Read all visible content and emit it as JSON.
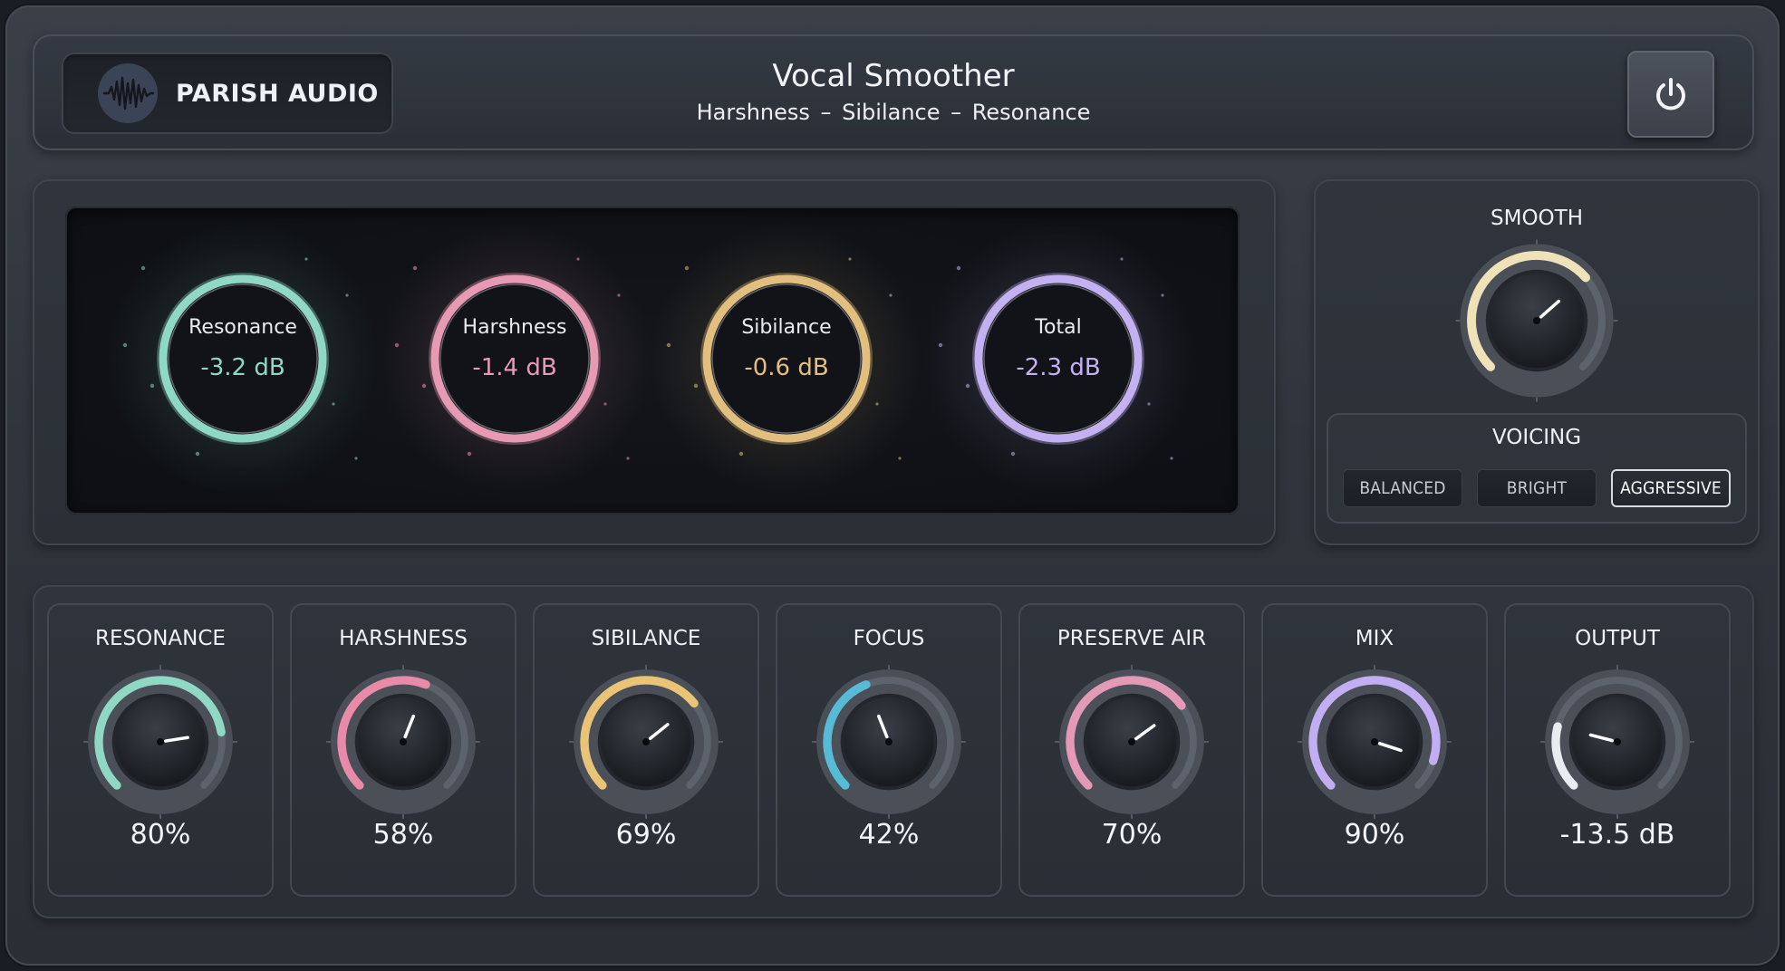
{
  "header": {
    "brand_name": "PARISH AUDIO",
    "title": "Vocal Smoother",
    "subtitle": "Harshness  –  Sibilance  –  Resonance"
  },
  "meters": [
    {
      "label": "Resonance",
      "value": "-3.2 dB",
      "color": "#8fd9c4"
    },
    {
      "label": "Harshness",
      "value": "-1.4 dB",
      "color": "#e79ab3"
    },
    {
      "label": "Sibilance",
      "value": "-0.6 dB",
      "color": "#e2bf7e"
    },
    {
      "label": "Total",
      "value": "-2.3 dB",
      "color": "#c4b1f2"
    }
  ],
  "smooth": {
    "label": "SMOOTH",
    "level": 0.68,
    "color": "#f0e2b8"
  },
  "voicing": {
    "label": "VOICING",
    "options": [
      "BALANCED",
      "BRIGHT",
      "AGGRESSIVE"
    ],
    "selected": "AGGRESSIVE"
  },
  "knobs": [
    {
      "label": "RESONANCE",
      "value": "80%",
      "level": 0.8,
      "color": "#8fd9c4"
    },
    {
      "label": "HARSHNESS",
      "value": "58%",
      "level": 0.58,
      "color": "#e88aa8"
    },
    {
      "label": "SIBILANCE",
      "value": "69%",
      "level": 0.69,
      "color": "#e9c477"
    },
    {
      "label": "FOCUS",
      "value": "42%",
      "level": 0.42,
      "color": "#56bcd6"
    },
    {
      "label": "PRESERVE AIR",
      "value": "70%",
      "level": 0.7,
      "color": "#e49ab6"
    },
    {
      "label": "MIX",
      "value": "90%",
      "level": 0.9,
      "color": "#c2aef2"
    },
    {
      "label": "OUTPUT",
      "value": "-13.5 dB",
      "level": 0.22,
      "color": "#e9ecf0"
    }
  ]
}
